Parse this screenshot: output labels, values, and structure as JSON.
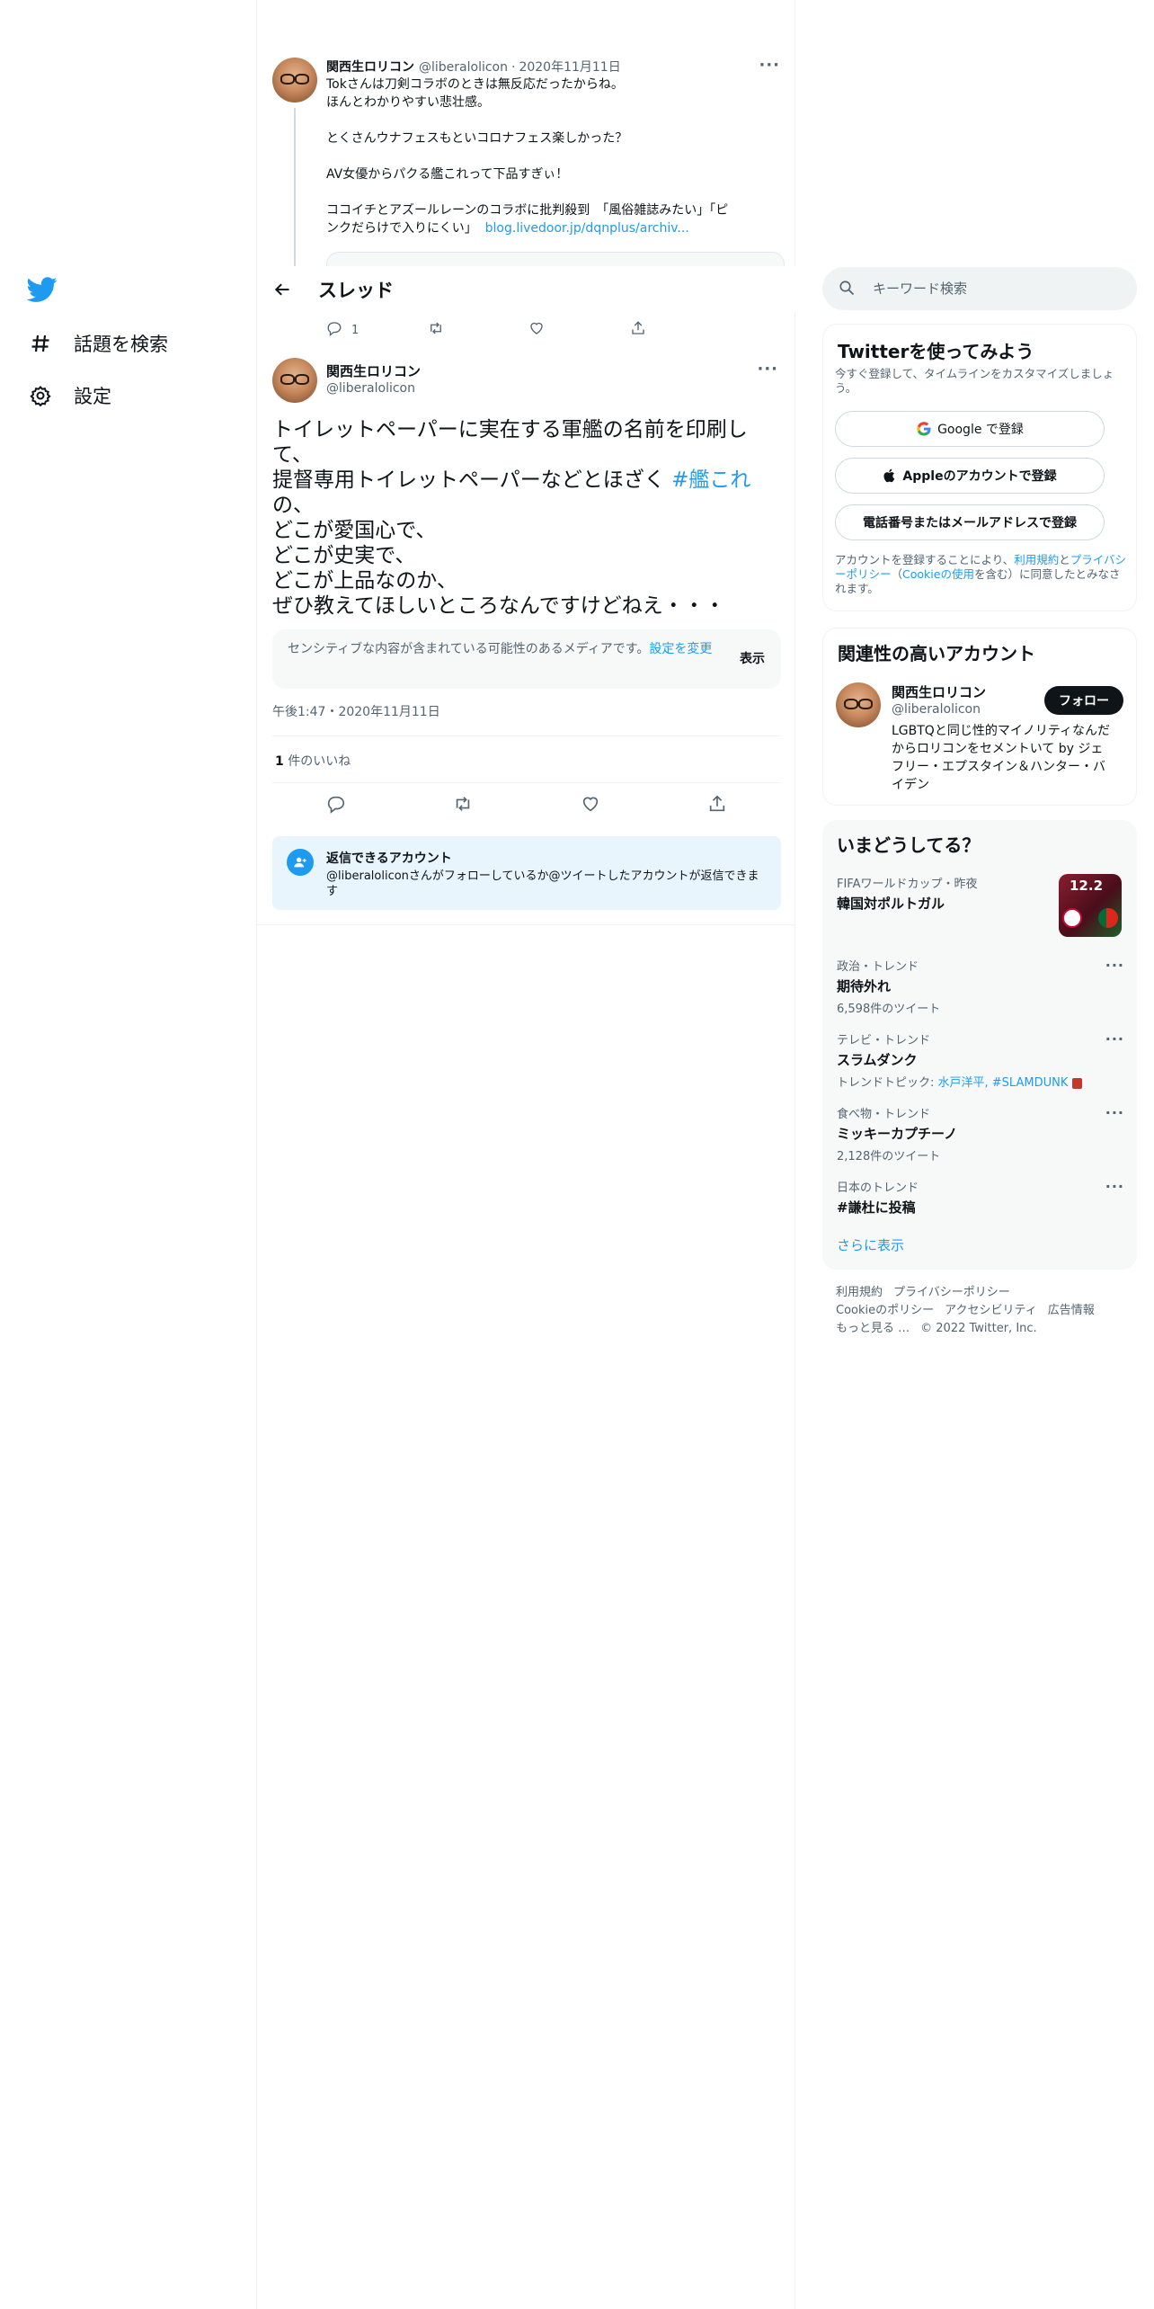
{
  "nav": {
    "explore_label": "話題を検索",
    "settings_label": "設定"
  },
  "prev_tweet": {
    "name": "関西生ロリコン",
    "handle": "@liberalolicon",
    "separator": "·",
    "date": "2020年11月11日",
    "lines": [
      "Tokさんは刀剣コラボのときは無反応だったからね。",
      "ほんとわかりやすい悲壮感。",
      "",
      "とくさんウナフェスもといコロナフェス楽しかった？",
      "",
      "AV女優からパクる艦これって下品すぎぃ！",
      "",
      "ココイチとアズールレーンのコラボに批判殺到　「風俗雑誌みたい」「ピ",
      "ンクだらけで入りにくい」"
    ],
    "link": "blog.livedoor.jp/dqnplus/archiv...",
    "reply_count": "1"
  },
  "header": {
    "title": "スレッド"
  },
  "focal_tweet": {
    "name": "関西生ロリコン",
    "handle": "@liberalolicon",
    "text_lines": [
      "トイレットペーパーに実在する軍艦の名前を印刷し",
      "て、",
      "提督専用トイレットペーパーなどとほざく",
      "の、",
      "どこが愛国心で、",
      "どこが史実で、",
      "どこが上品なのか、",
      "ぜひ教えてほしいところなんですけどねえ・・・"
    ],
    "hashtag": "#艦これ",
    "sensitive_msg": "センシティブな内容が含まれている可能性のあるメディアです。",
    "sensitive_link": "設定を変更",
    "show_label": "表示",
    "timestamp": "午後1:47・2020年11月11日",
    "likes_count": "1",
    "likes_label": "件のいいね",
    "reply_title": "返信できるアカウント",
    "reply_desc": "@liberaloliconさんがフォローしているか@ツイートしたアカウントが返信できます"
  },
  "search": {
    "placeholder": "キーワード検索"
  },
  "signup": {
    "title": "Twitterを使ってみよう",
    "subtitle": "今すぐ登録して、タイムラインをカスタマイズしましょう。",
    "google_label": "Google で登録",
    "apple_label": "Appleのアカウントで登録",
    "phone_label": "電話番号またはメールアドレスで登録",
    "terms_prefix": "アカウントを登録することにより、",
    "terms_link": "利用規約",
    "terms_and": "と",
    "privacy_link": "プライバシーポリシー",
    "cookie_open": "（",
    "cookie_link": "Cookieの使用",
    "terms_suffix": "を含む）に同意したとみなされます。"
  },
  "related": {
    "title": "関連性の高いアカウント",
    "name": "関西生ロリコン",
    "handle": "@liberalolicon",
    "bio": "LGBTQと同じ性的マイノリティなんだからロリコンをセメントいて by ジェフリー・エプスタイン＆ハンター・バイデン",
    "follow_label": "フォロー"
  },
  "trends": {
    "title": "いまどうしてる？",
    "items": [
      {
        "context": "FIFAワールドカップ・昨夜",
        "name": "韓国対ポルトガル",
        "count": ""
      },
      {
        "context": "政治・トレンド",
        "name": "期待外れ",
        "count": "6,598件のツイート"
      },
      {
        "context": "テレビ・トレンド",
        "name": "スラムダンク",
        "count": ""
      },
      {
        "context": "食べ物・トレンド",
        "name": "ミッキーカプチーノ",
        "count": "2,128件のツイート"
      },
      {
        "context": "日本のトレンド",
        "name": "#謙杜に投稿",
        "count": ""
      }
    ],
    "topic_prefix": "トレンドトピック: ",
    "topic_links": "水戸洋平, #SLAMDUNK",
    "image_text": "12.2",
    "show_more": "さらに表示"
  },
  "footer": {
    "links": [
      "利用規約",
      "プライバシーポリシー",
      "Cookieのポリシー",
      "アクセシビリティ",
      "広告情報",
      "もっと見る …"
    ],
    "copyright": "© 2022 Twitter, Inc."
  },
  "colors": {
    "accent": "#1d9bf0",
    "text_primary": "#0f1419",
    "text_secondary": "#536471"
  }
}
